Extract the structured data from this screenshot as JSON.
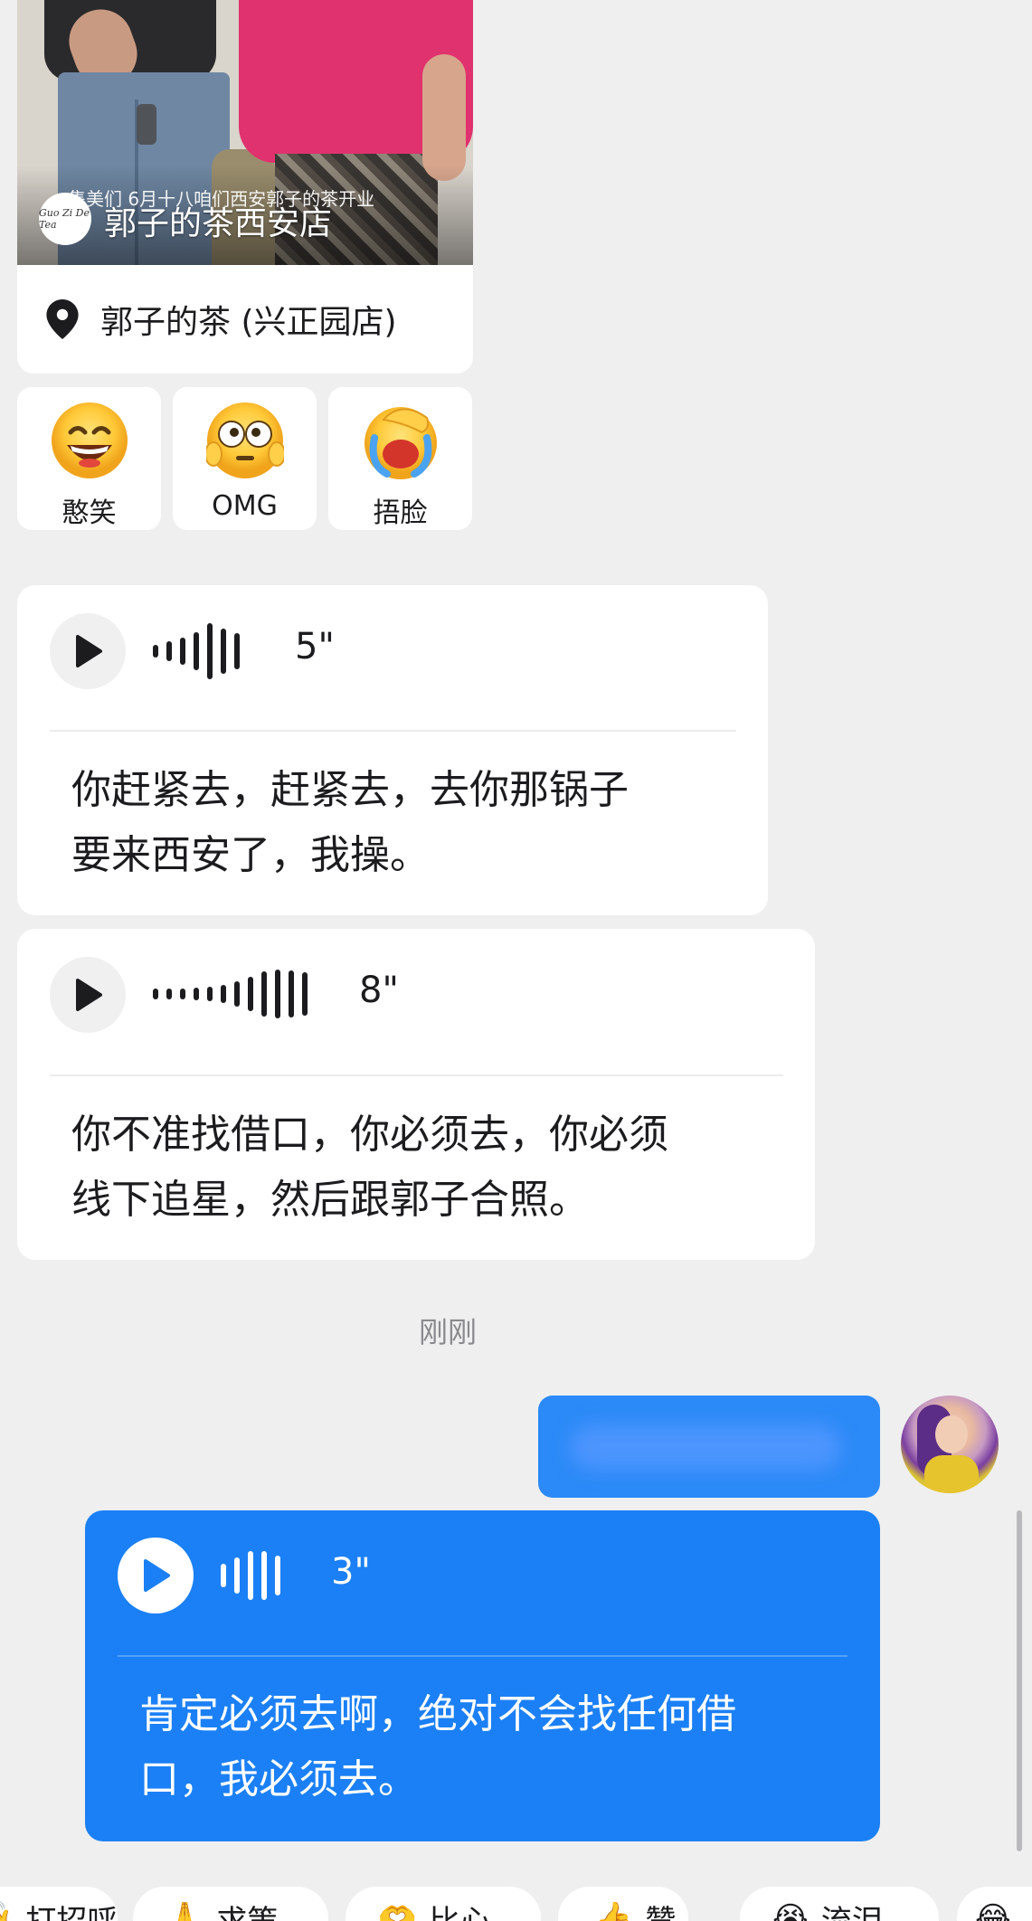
{
  "video_card": {
    "caption_overlay": "集美们 6月十八咱们西安郭子的茶开业",
    "logo_text": "Guo Zi De Tea",
    "channel_name": "郭子的茶西安店",
    "location": "郭子的茶 (兴正园店)"
  },
  "reactions": [
    {
      "label": "憨笑",
      "icon": "grin-emoji-icon"
    },
    {
      "label": "OMG",
      "icon": "omg-emoji-icon"
    },
    {
      "label": "捂脸",
      "icon": "facepalm-emoji-icon"
    }
  ],
  "messages": [
    {
      "duration": "5\"",
      "transcript_line1": "你赶紧去，赶紧去，去你那锅子",
      "transcript_line2": "要来西安了，我操。"
    },
    {
      "duration": "8\"",
      "transcript_line1": "你不准找借口，你必须去，你必须",
      "transcript_line2": "线下追星，然后跟郭子合照。"
    }
  ],
  "timestamp": "刚刚",
  "sent_voice": {
    "duration": "3\"",
    "transcript_line1": "肯定必须去啊，绝对不会找任何借",
    "transcript_line2": "口，我必须去。"
  },
  "quick_replies": [
    {
      "label": "打招呼",
      "icon": "wave-hand-icon"
    },
    {
      "label": "求策",
      "icon": "raised-hand-icon"
    },
    {
      "label": "比心",
      "icon": "heart-hands-icon"
    },
    {
      "label": "赞",
      "icon": "thumbs-up-icon"
    },
    {
      "label": "流泪",
      "icon": "tears-emoji-icon"
    }
  ],
  "colors": {
    "background": "#efefef",
    "sent_bubble": "#1b80f5",
    "received_bubble": "#ffffff"
  }
}
